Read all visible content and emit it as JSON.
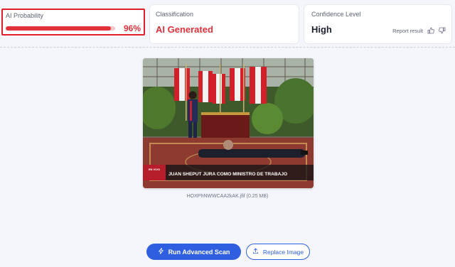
{
  "summary": {
    "probability": {
      "label": "AI Probability",
      "value_text": "96%",
      "value_fraction": 0.96
    },
    "classification": {
      "label": "Classification",
      "value": "AI Generated"
    },
    "confidence": {
      "label": "Confidence Level",
      "value": "High",
      "report_label": "Report result"
    }
  },
  "image": {
    "banner_tag": "EN VIVO",
    "caption": "JUAN SHEPUT JURA COMO MINISTRO DE TRABAJO",
    "filename_text": "HOXPhNWWCAA2kAK.jfif (0.25 MB)"
  },
  "actions": {
    "run_label": "Run Advanced Scan",
    "replace_label": "Replace Image"
  },
  "colors": {
    "accent_red": "#e0323b",
    "primary_blue": "#2f5fe0",
    "highlight_border": "#e11d2a"
  },
  "icons": [
    "thumbs-up-icon",
    "thumbs-down-icon",
    "bolt-icon",
    "upload-icon"
  ]
}
